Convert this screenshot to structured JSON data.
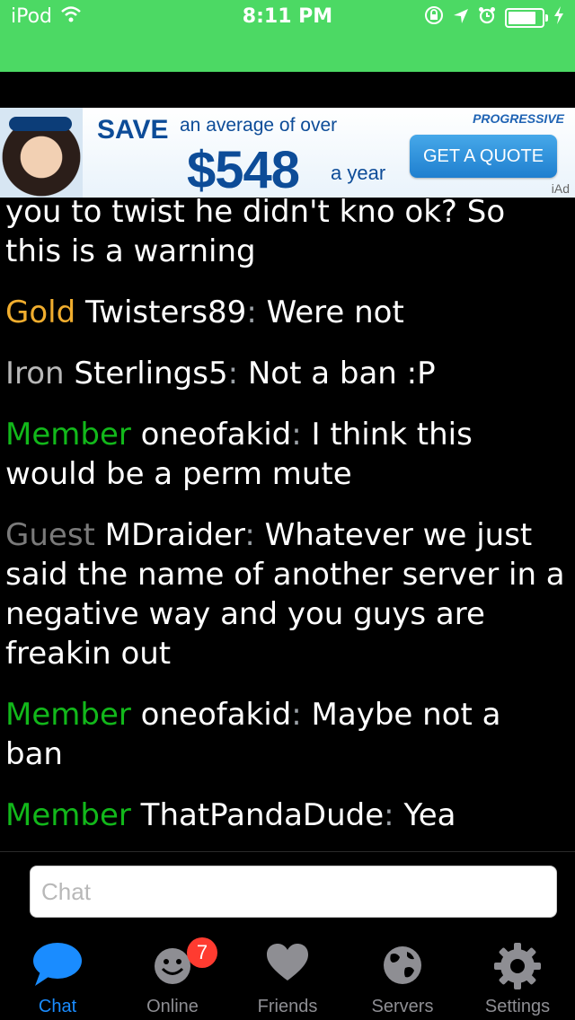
{
  "status_bar": {
    "device": "iPod",
    "time": "8:11 PM"
  },
  "ad": {
    "save": "SAVE",
    "average": "an average of over",
    "amount": "$548",
    "period": "a year",
    "brand": "PROGRESSIVE",
    "cta": "GET A QUOTE",
    "label": "iAd"
  },
  "messages": [
    {
      "rank": "",
      "user": "",
      "text": "you to twist he didn't kno ok? So this is a warning"
    },
    {
      "rank": "Gold",
      "rank_color": "#f0ad2e",
      "user": "Twisters89",
      "text": "Were not"
    },
    {
      "rank": "Iron",
      "rank_color": "#b7b7b7",
      "user": "Sterlings5",
      "text": "Not a ban :P"
    },
    {
      "rank": "Member",
      "rank_color": "#12b81a",
      "user": "oneofakid",
      "text": "I think this would be a perm mute"
    },
    {
      "rank": "Guest",
      "rank_color": "#7a7a7a",
      "user": "MDraider",
      "text": "Whatever we just said the name of another server in a negative way and you guys are freakin out"
    },
    {
      "rank": "Member",
      "rank_color": "#12b81a",
      "user": "oneofakid",
      "text": "Maybe not a ban"
    },
    {
      "rank": "Member",
      "rank_color": "#12b81a",
      "user": "ThatPandaDude",
      "text": "Yea"
    }
  ],
  "chat_input": {
    "placeholder": "Chat",
    "value": ""
  },
  "tabs": [
    {
      "label": "Chat",
      "icon": "chat-bubble-icon",
      "active": true
    },
    {
      "label": "Online",
      "icon": "smiley-icon",
      "badge": "7"
    },
    {
      "label": "Friends",
      "icon": "heart-icon"
    },
    {
      "label": "Servers",
      "icon": "globe-icon"
    },
    {
      "label": "Settings",
      "icon": "gear-icon"
    }
  ],
  "colors": {
    "status_bar": "#4cd964",
    "active_tab": "#1a8cff",
    "badge": "#ff3b30"
  }
}
